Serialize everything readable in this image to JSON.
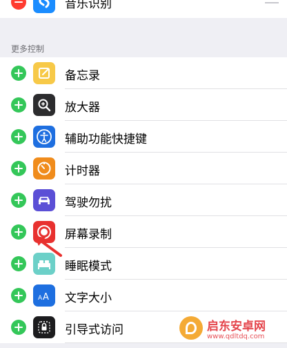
{
  "included_row": {
    "label": "音乐识别",
    "icon": "shazam-icon",
    "icon_color": "#1a8cff"
  },
  "more_controls": {
    "header": "更多控制",
    "items": [
      {
        "label": "备忘录",
        "icon": "notes-icon",
        "icon_color": "#f7c948"
      },
      {
        "label": "放大器",
        "icon": "magnifier-icon",
        "icon_color": "#2c2c2e"
      },
      {
        "label": "辅助功能快捷键",
        "icon": "accessibility-icon",
        "icon_color": "#1e6fe0"
      },
      {
        "label": "计时器",
        "icon": "timer-icon",
        "icon_color": "#f08c1c"
      },
      {
        "label": "驾驶勿扰",
        "icon": "car-icon",
        "icon_color": "#5b4fd6"
      },
      {
        "label": "屏幕录制",
        "icon": "screen-record-icon",
        "icon_color": "#e8312f"
      },
      {
        "label": "睡眠模式",
        "icon": "bed-icon",
        "icon_color": "#6cd0c8"
      },
      {
        "label": "文字大小",
        "icon": "text-size-icon",
        "icon_color": "#1e6fe0"
      },
      {
        "label": "引导式访问",
        "icon": "lock-icon",
        "icon_color": "#1c1c1e"
      }
    ]
  },
  "watermark": {
    "title": "启东安卓网",
    "url": "www.qdltdq.com"
  },
  "accent_colors": {
    "remove": "#ff3b30",
    "add": "#34c759",
    "arrow": "#e8312f"
  }
}
